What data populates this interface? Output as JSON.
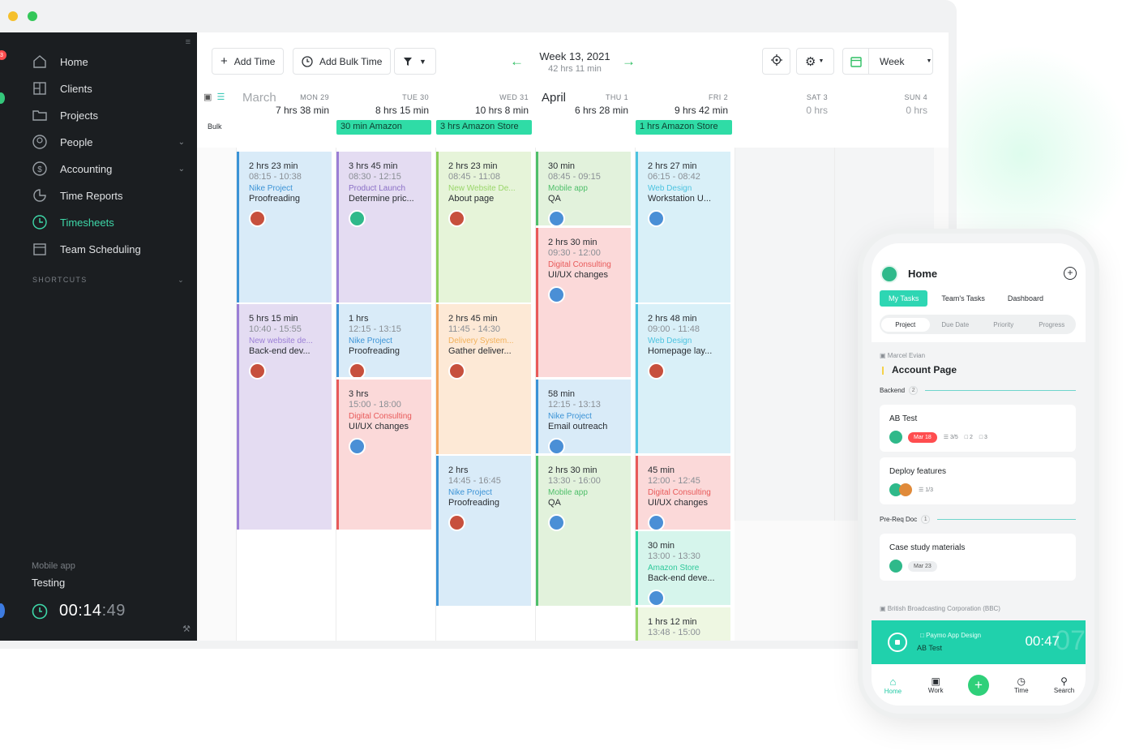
{
  "colors": {
    "accent": "#2fdca6",
    "sidebar_bg": "#1b1e21",
    "nav_active": "#3ed7a8"
  },
  "sidebar": {
    "badge": "3",
    "items": [
      {
        "label": "Home",
        "icon": "home-icon"
      },
      {
        "label": "Clients",
        "icon": "building-icon"
      },
      {
        "label": "Projects",
        "icon": "folder-icon"
      },
      {
        "label": "People",
        "icon": "person-icon"
      },
      {
        "label": "Accounting",
        "icon": "dollar-icon"
      },
      {
        "label": "Time Reports",
        "icon": "pie-chart-icon"
      },
      {
        "label": "Timesheets",
        "icon": "clock-icon"
      },
      {
        "label": "Team Scheduling",
        "icon": "calendar-icon"
      }
    ],
    "shortcuts_label": "SHORTCUTS",
    "timer": {
      "project": "Mobile app",
      "task": "Testing",
      "time": "00:14",
      "seconds": ":49"
    }
  },
  "toolbar": {
    "add_time": "Add Time",
    "add_bulk_time": "Add Bulk Time",
    "week_title": "Week 13, 2021",
    "week_total": "42 hrs 11 min",
    "view_select": "Week"
  },
  "calendar": {
    "months": [
      "March",
      "April"
    ],
    "bulk_label": "Bulk",
    "days": [
      {
        "name": "MON 29",
        "total": "7 hrs 38 min"
      },
      {
        "name": "TUE 30",
        "total": "8 hrs 15 min"
      },
      {
        "name": "WED 31",
        "total": "10 hrs 8 min"
      },
      {
        "name": "THU 1",
        "total": "6 hrs 28 min"
      },
      {
        "name": "FRI 2",
        "total": "9 hrs 42 min"
      },
      {
        "name": "SAT 3",
        "total": "0 hrs"
      },
      {
        "name": "SUN 4",
        "total": "0 hrs"
      }
    ],
    "allday": [
      "30 min Amazon",
      "3 hrs Amazon Store",
      "1 hrs Amazon Store"
    ],
    "entries": [
      {
        "dur": "2 hrs 23 min",
        "time": "08:15 - 10:38",
        "project": "Nike Project",
        "task": "Proofreading",
        "bg": "#d9ebf8",
        "border": "#3b93d6",
        "pc": "#3b93d6",
        "av": "#c7503d"
      },
      {
        "dur": "5 hrs 15 min",
        "time": "10:40 - 15:55",
        "project": "New website de...",
        "task": "Back-end dev...",
        "bg": "#e4dcf2",
        "border": "#9b7fd6",
        "pc": "#9b7fd6",
        "av": "#c7503d"
      },
      {
        "dur": "3 hrs 45 min",
        "time": "08:30 - 12:15",
        "project": "Product Launch",
        "task": "Determine pric...",
        "bg": "#e4dcf2",
        "border": "#9b7fd6",
        "pc": "#8a6fc6",
        "av": "#2fb98a"
      },
      {
        "dur": "1 hrs",
        "time": "12:15 - 13:15",
        "project": "Nike Project",
        "task": "Proofreading",
        "bg": "#d9ebf8",
        "border": "#3b93d6",
        "pc": "#3b93d6",
        "av": "#c7503d"
      },
      {
        "dur": "3 hrs",
        "time": "15:00 - 18:00",
        "project": "Digital Consulting",
        "task": "UI/UX changes",
        "bg": "#fbd9d9",
        "border": "#e85a5a",
        "pc": "#e85a5a",
        "av": "#4a8fd6"
      },
      {
        "dur": "2 hrs 23 min",
        "time": "08:45 - 11:08",
        "project": "New Website De...",
        "task": "About page",
        "bg": "#e6f4d9",
        "border": "#8ccf5a",
        "pc": "#9ad66a",
        "av": "#c7503d"
      },
      {
        "dur": "2 hrs 45 min",
        "time": "11:45 - 14:30",
        "project": "Delivery System...",
        "task": "Gather deliver...",
        "bg": "#fde9d6",
        "border": "#f2a45a",
        "pc": "#f2b15a",
        "av": "#c7503d"
      },
      {
        "dur": "2 hrs",
        "time": "14:45 - 16:45",
        "project": "Nike Project",
        "task": "Proofreading",
        "bg": "#d9ebf8",
        "border": "#3b93d6",
        "pc": "#3b93d6",
        "av": "#c7503d"
      },
      {
        "dur": "30 min",
        "time": "08:45 - 09:15",
        "project": "Mobile app",
        "task": "QA",
        "bg": "#e2f2dc",
        "border": "#4fbf6a",
        "pc": "#4fbf6a",
        "av": "#4a8fd6"
      },
      {
        "dur": "2 hrs 30 min",
        "time": "09:30 - 12:00",
        "project": "Digital Consulting",
        "task": "UI/UX changes",
        "bg": "#fbd9d9",
        "border": "#e85a5a",
        "pc": "#e85a5a",
        "av": "#4a8fd6"
      },
      {
        "dur": "58 min",
        "time": "12:15 - 13:13",
        "project": "Nike Project",
        "task": "Email outreach",
        "bg": "#d9ebf8",
        "border": "#3b93d6",
        "pc": "#3b93d6",
        "av": "#4a8fd6"
      },
      {
        "dur": "2 hrs 30 min",
        "time": "13:30 - 16:00",
        "project": "Mobile app",
        "task": "QA",
        "bg": "#e2f2dc",
        "border": "#4fbf6a",
        "pc": "#4fbf6a",
        "av": "#4a8fd6"
      },
      {
        "dur": "2 hrs 27 min",
        "time": "06:15 - 08:42",
        "project": "Web Design",
        "task": "Workstation U...",
        "bg": "#d9f0f8",
        "border": "#4cc3e0",
        "pc": "#4cc3e0",
        "av": "#4a8fd6"
      },
      {
        "dur": "2 hrs 48 min",
        "time": "09:00 - 11:48",
        "project": "Web Design",
        "task": "Homepage lay...",
        "bg": "#d9f0f8",
        "border": "#4cc3e0",
        "pc": "#4cc3e0",
        "av": "#c7503d"
      },
      {
        "dur": "45 min",
        "time": "12:00 - 12:45",
        "project": "Digital Consulting",
        "task": "UI/UX changes",
        "bg": "#fbd9d9",
        "border": "#e85a5a",
        "pc": "#e85a5a",
        "av": "#4a8fd6"
      },
      {
        "dur": "30 min",
        "time": "13:00 - 13:30",
        "project": "Amazon Store",
        "task": "Back-end deve...",
        "bg": "#d6f5ec",
        "border": "#2fd6a3",
        "pc": "#2fc99b",
        "av": "#4a8fd6"
      },
      {
        "dur": "1 hrs 12 min",
        "time": "13:48 - 15:00",
        "project": "",
        "task": "",
        "bg": "#eef7e2",
        "border": "#9ad66a",
        "pc": "#9ad66a",
        "av": ""
      }
    ]
  },
  "phone": {
    "title": "Home",
    "tabs": [
      "My Tasks",
      "Team's Tasks",
      "Dashboard"
    ],
    "segments": [
      "Project",
      "Due Date",
      "Priority",
      "Progress"
    ],
    "owner": "Marcel Evian",
    "project": "Account Page",
    "section1": {
      "label": "Backend",
      "count": "2"
    },
    "card1": {
      "title": "AB Test",
      "date": "Mar 18",
      "subtasks": "3/5",
      "comments": "2",
      "files": "3"
    },
    "card2": {
      "title": "Deploy features",
      "subtasks": "1/3"
    },
    "section2": {
      "label": "Pre-Req Doc",
      "count": "1"
    },
    "card3": {
      "title": "Case study materials",
      "date": "Mar 23"
    },
    "client": "British Broadcasting Corporation (BBC)",
    "timer": {
      "project": "Paymo App Design",
      "task": "AB Test",
      "time": "00:47",
      "ghost": "07"
    },
    "nav": [
      "Home",
      "Work",
      "Time",
      "Search"
    ]
  }
}
